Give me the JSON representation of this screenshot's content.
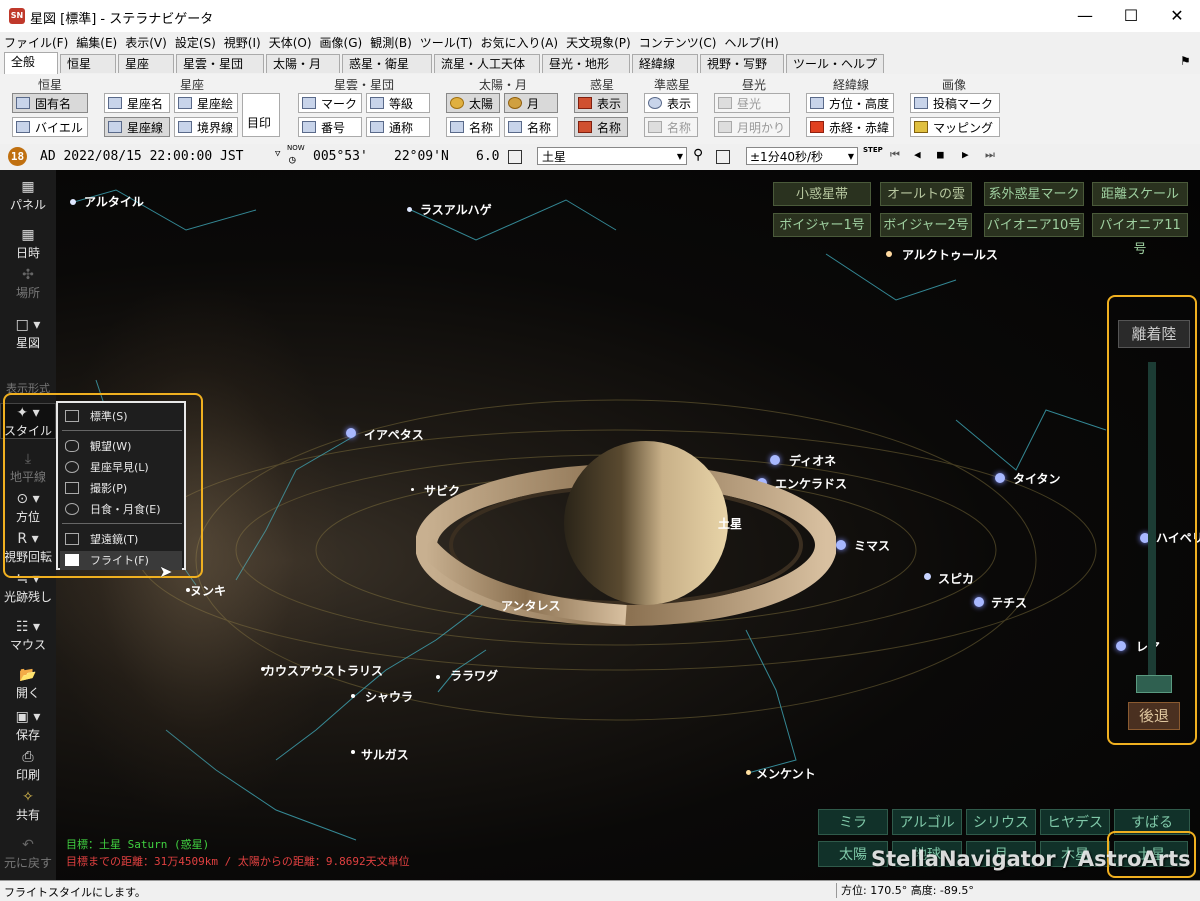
{
  "window": {
    "title": "星図 [標準] - ステラナビゲータ"
  },
  "menubar": [
    "ファイル(F)",
    "編集(E)",
    "表示(V)",
    "設定(S)",
    "視野(I)",
    "天体(O)",
    "画像(G)",
    "観測(B)",
    "ツール(T)",
    "お気に入り(A)",
    "天文現象(P)",
    "コンテンツ(C)",
    "ヘルプ(H)"
  ],
  "tabs": [
    "全般",
    "恒星",
    "星座",
    "星雲・星団",
    "太陽・月",
    "惑星・衛星",
    "流星・人工天体",
    "昼光・地形",
    "経緯線",
    "視野・写野",
    "ツール・ヘルプ"
  ],
  "ribbon": {
    "groups": [
      "恒星",
      "星座",
      "星雲・星団",
      "太陽・月",
      "惑星",
      "準惑星",
      "昼光",
      "経緯線",
      "画像"
    ],
    "buttons": [
      "固有名",
      "バイエル",
      "星座名",
      "星座絵",
      "星座線",
      "境界線",
      "目印",
      "マーク",
      "等級",
      "番号",
      "通称",
      "太陽",
      "月",
      "名称",
      "名称",
      "表示",
      "名称",
      "表示",
      "名称",
      "昼光",
      "月明かり",
      "方位・高度",
      "赤経・赤緯",
      "投稿マーク",
      "マッピング"
    ]
  },
  "toolbar": {
    "badge": "18",
    "datetime": "AD 2022/08/15 22:00:00 JST",
    "now_label": "NOW",
    "longitude": "005°53'",
    "latitude": "22°09'N",
    "fov": "6.0",
    "target_select": "土星",
    "step_select": "±1分40秒/秒",
    "step_label": "STEP"
  },
  "sidebar": [
    "パネル",
    "日時",
    "場所",
    "星図",
    "表示形式",
    "スタイル",
    "地平線",
    "方位",
    "視野回転",
    "光跡残し",
    "マウス",
    "開く",
    "保存",
    "印刷",
    "共有",
    "元に戻す"
  ],
  "style_menu": [
    "標準(S)",
    "観望(W)",
    "星座早見(L)",
    "撮影(P)",
    "日食・月食(E)",
    "望遠鏡(T)",
    "フライト(F)"
  ],
  "top_buttons": [
    "小惑星帯",
    "オールトの雲",
    "系外惑星マーク",
    "距離スケール",
    "ボイジャー1号",
    "ボイジャー2号",
    "パイオニア10号",
    "パイオニア11号"
  ],
  "flight": {
    "top_label": "離着陸",
    "back_label": "後退"
  },
  "bottom_buttons": [
    "ミラ",
    "アルゴル",
    "シリウス",
    "ヒヤデス",
    "すばる",
    "太陽",
    "地球",
    "月",
    "木星",
    "土星"
  ],
  "labels": {
    "altair": "アルタイル",
    "rasalhague": "ラスアルハゲ",
    "arcturus": "アルクトゥールス",
    "iapetus": "イアペタス",
    "dione": "ディオネ",
    "enceladus": "エンケラドス",
    "titan": "タイタン",
    "sabik": "サビク",
    "saturn": "土星",
    "mimas": "ミマス",
    "hyperion": "ハイペリ",
    "spica": "スピカ",
    "tethys": "テチス",
    "nunki": "ヌンキ",
    "antares": "アンタレス",
    "rhea": "レア",
    "kausaustralis": "カウスアウストラリス",
    "lalawag": "ララワグ",
    "shaula": "シャウラ",
    "sargas": "サルガス",
    "menkent": "メンケント"
  },
  "info": {
    "target": "目標：土星 Saturn (惑星)",
    "distance": "目標までの距離：31万4509km / 太陽からの距離：9.8692天文単位"
  },
  "watermark": "StellaNavigator / AstroArts",
  "status": {
    "message": "フライトスタイルにします。",
    "coords": "方位: 170.5° 高度: -89.5°"
  },
  "colors": {
    "highlight": "#f0b020",
    "sky_button": "#7fc8a8",
    "info_green": "#40d040",
    "info_red": "#e04040"
  }
}
